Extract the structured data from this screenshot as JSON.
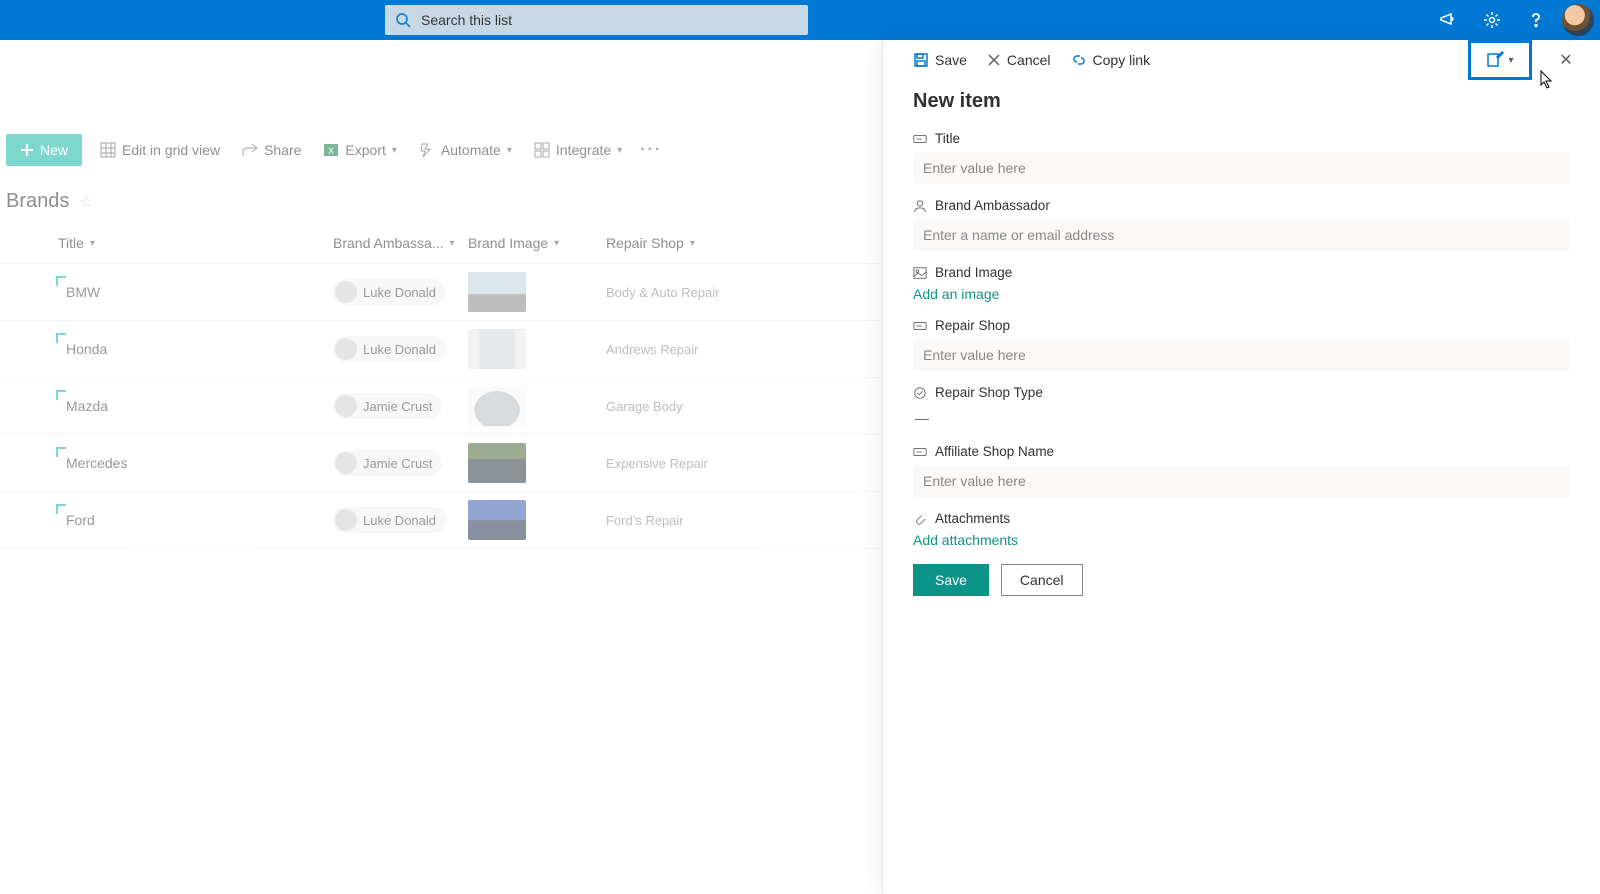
{
  "header": {
    "search_placeholder": "Search this list"
  },
  "commandbar": {
    "new": "New",
    "edit_grid": "Edit in grid view",
    "share": "Share",
    "export": "Export",
    "automate": "Automate",
    "integrate": "Integrate"
  },
  "list": {
    "title": "Brands",
    "columns": {
      "title": "Title",
      "ambassador": "Brand Ambassa...",
      "image": "Brand Image",
      "shop": "Repair Shop"
    },
    "rows": [
      {
        "title": "BMW",
        "ambassador": "Luke Donald",
        "thumb": "bmw",
        "shop": "Body & Auto Repair"
      },
      {
        "title": "Honda",
        "ambassador": "Luke Donald",
        "thumb": "honda",
        "shop": "Andrews Repair"
      },
      {
        "title": "Mazda",
        "ambassador": "Jamie Crust",
        "thumb": "mazda",
        "shop": "Garage Body"
      },
      {
        "title": "Mercedes",
        "ambassador": "Jamie Crust",
        "thumb": "merc",
        "shop": "Expensive Repair"
      },
      {
        "title": "Ford",
        "ambassador": "Luke Donald",
        "thumb": "ford",
        "shop": "Ford's Repair"
      }
    ]
  },
  "panel": {
    "cmd_save": "Save",
    "cmd_cancel": "Cancel",
    "cmd_copylink": "Copy link",
    "heading": "New item",
    "fields": {
      "title_label": "Title",
      "title_ph": "Enter value here",
      "amb_label": "Brand Ambassador",
      "amb_ph": "Enter a name or email address",
      "img_label": "Brand Image",
      "img_action": "Add an image",
      "shop_label": "Repair Shop",
      "shop_ph": "Enter value here",
      "shoptype_label": "Repair Shop Type",
      "shoptype_value": "—",
      "aff_label": "Affiliate Shop Name",
      "aff_ph": "Enter value here",
      "att_label": "Attachments",
      "att_action": "Add attachments"
    },
    "btn_save": "Save",
    "btn_cancel": "Cancel"
  }
}
